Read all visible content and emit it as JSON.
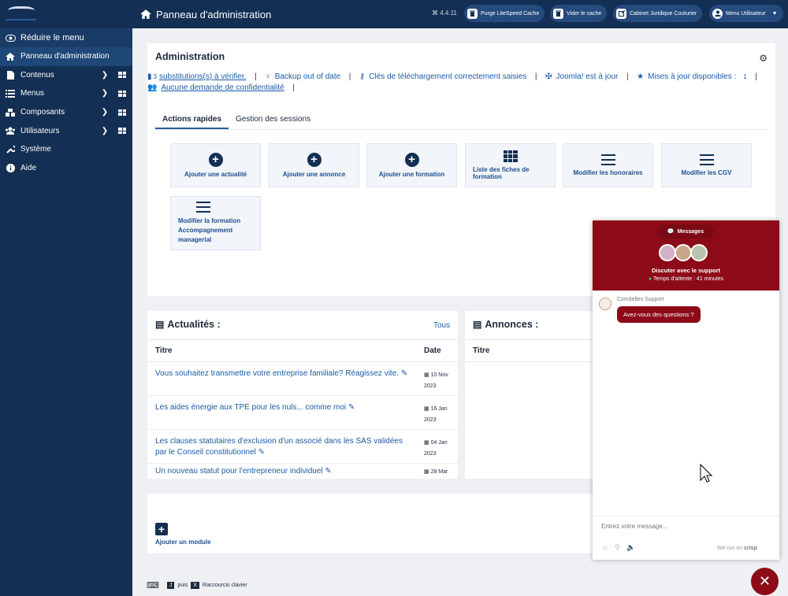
{
  "sidebar": {
    "toggle_label": "Réduire le menu",
    "items": [
      {
        "label": "Panneau d'administration"
      },
      {
        "label": "Contenus"
      },
      {
        "label": "Menus"
      },
      {
        "label": "Composants"
      },
      {
        "label": "Utilisateurs"
      },
      {
        "label": "Système"
      },
      {
        "label": "Aide"
      }
    ]
  },
  "header": {
    "title": "Panneau d'administration",
    "version": "⌘ 4.4.11",
    "buttons": {
      "purge": "Purge LiteSpeed Cache",
      "cache": "Vider le cache",
      "site": "Cabinet Juridique Couturier",
      "user": "Menu Utilisateur"
    }
  },
  "admin": {
    "title": "Administration",
    "status": {
      "substitutions_count": "3",
      "substitutions": "substitutions(s) à vérifier.",
      "backup": "Backup out of date",
      "keys": "Clés de téléchargement correctement saisies",
      "joomla": "Joomla! est à jour",
      "updates": "Mises à jour disponibles :",
      "updates_count": "1",
      "privacy": "Aucune demande de confidentialité"
    },
    "tabs": [
      "Actions rapides",
      "Gestion des sessions"
    ],
    "quick": [
      "Ajouter une actualité",
      "Ajouter une annonce",
      "Ajouter une formation",
      "Liste des fiches de formation",
      "Modifier les honoraires",
      "Modifier les CGV",
      "Modifier la formation Accompagnement managerial"
    ]
  },
  "news": {
    "title": "Actualités :",
    "all": "Tous",
    "col_title": "Titre",
    "col_date": "Date",
    "rows": [
      {
        "title": "Vous souhaitez transmettre votre entreprise familiale? Réagissez vite.",
        "date1": "10 Nov",
        "date2": "2023"
      },
      {
        "title": "Les aides énergie aux TPE pour les nuls... comme moi",
        "date1": "16 Jan",
        "date2": "2023"
      },
      {
        "title": "Les clauses statutaires d'exclusion d'un associé dans les SAS validées par le Conseil constitutionnel",
        "date1": "04 Jan",
        "date2": "2023"
      },
      {
        "title": "Un nouveau statut pour l'entrepreneur individuel",
        "date1": "28 Mar",
        "date2": ""
      }
    ]
  },
  "ads": {
    "title": "Annonces :",
    "col_title": "Titre"
  },
  "module": {
    "add_label": "Ajouter un module"
  },
  "shortcuts": {
    "key_j": "J",
    "then": "puis",
    "key_x": "X",
    "label": "Raccourcis clavier"
  },
  "chat": {
    "tab": "Messages",
    "support": "Discuter avec le support",
    "wait": "Temps d'attente : 41 minutes",
    "agent": "Com3elles Support",
    "message": "Avez-vous des questions ?",
    "input_placeholder": "Entrez votre message...",
    "powered": "We run on",
    "brand": "crisp"
  }
}
